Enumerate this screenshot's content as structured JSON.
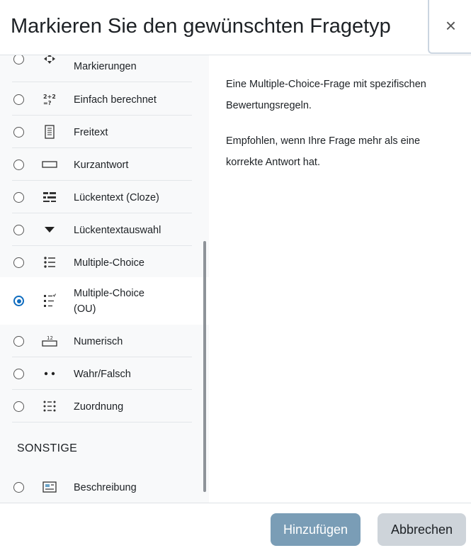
{
  "dialog": {
    "title": "Markieren Sie den gewünschten Fragetyp",
    "close_label": "×"
  },
  "options": [
    {
      "label": "Markierungen",
      "icon": "drag-markers-icon",
      "selected": false
    },
    {
      "label": "Einfach berechnet",
      "icon": "calculated-simple-icon",
      "selected": false
    },
    {
      "label": "Freitext",
      "icon": "essay-icon",
      "selected": false
    },
    {
      "label": "Kurzantwort",
      "icon": "short-answer-icon",
      "selected": false
    },
    {
      "label": "Lückentext (Cloze)",
      "icon": "cloze-icon",
      "selected": false
    },
    {
      "label": "Lückentextauswahl",
      "icon": "dropdown-triangle-icon",
      "selected": false
    },
    {
      "label": "Multiple-Choice",
      "icon": "multichoice-list-icon",
      "selected": false
    },
    {
      "label": "Multiple-Choice",
      "label2": "(OU)",
      "icon": "multichoice-ou-icon",
      "selected": true
    },
    {
      "label": "Numerisch",
      "icon": "numerical-icon",
      "selected": false
    },
    {
      "label": "Wahr/Falsch",
      "icon": "true-false-icon",
      "selected": false
    },
    {
      "label": "Zuordnung",
      "icon": "matching-icon",
      "selected": false
    }
  ],
  "other_section": {
    "heading": "SONSTIGE",
    "items": [
      {
        "label": "Beschreibung",
        "icon": "description-icon",
        "selected": false
      }
    ]
  },
  "description": {
    "line1a": "Eine Multiple-Choice-Frage mit spezifischen",
    "line1b": "Bewertungsregeln.",
    "line2a": "Empfohlen, wenn Ihre Frage mehr als eine",
    "line2b": "korrekte Antwort hat."
  },
  "footer": {
    "add_label": "Hinzufügen",
    "cancel_label": "Abbrechen"
  },
  "colors": {
    "accent": "#0f6cbf",
    "add_button": "#7a9db6",
    "cancel_button": "#ced4da"
  }
}
